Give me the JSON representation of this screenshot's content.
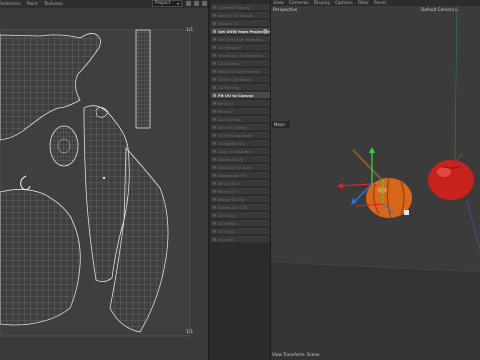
{
  "uv_editor": {
    "menu": [
      "Selection",
      "Paint",
      "Textures"
    ],
    "project_select": "Project",
    "corner_top": "1/1",
    "corner_bottom": "1/1"
  },
  "command_panel": {
    "items": [
      {
        "label": "Optimal Mapping"
      },
      {
        "label": "Realign UV Islands"
      },
      {
        "label": "Terrace UV"
      },
      {
        "label": "Set UVW from Projection",
        "active": true,
        "settings_icon": true
      },
      {
        "label": "Set UVW from Selection"
      },
      {
        "label": "UV Manager"
      },
      {
        "label": "Transform UV Selection"
      },
      {
        "label": "UV Unwrap"
      },
      {
        "label": "Relax UV with Pinning"
      },
      {
        "label": "Stretch UV Islands"
      },
      {
        "label": "UV Packing"
      },
      {
        "label": "Fit UV to Canvas",
        "active": true
      },
      {
        "label": "Mirror U"
      },
      {
        "label": "Mirror V"
      },
      {
        "label": "Lock UV Sel"
      },
      {
        "label": "UV Grid Layout"
      },
      {
        "label": "UV Rectangularize"
      },
      {
        "label": "Straighten UV"
      },
      {
        "label": "Align to Neighbor"
      },
      {
        "label": "Distribute UV"
      },
      {
        "label": "Equalize UV Scale"
      },
      {
        "label": "Randomize UV"
      },
      {
        "label": "Mirror UV X"
      },
      {
        "label": "Mirror UV Y"
      },
      {
        "label": "Rotate UV CW"
      },
      {
        "label": "Rotate UV CCW"
      },
      {
        "label": "UV Tools"
      },
      {
        "label": "UV Peeler"
      },
      {
        "label": "UV Snap"
      },
      {
        "label": "Brushes"
      }
    ]
  },
  "viewport": {
    "menu": [
      "View",
      "Cameras",
      "Display",
      "Options",
      "Filter",
      "Panel"
    ],
    "view_name": "Perspective",
    "camera": "Default Camera",
    "move_label": "Move",
    "status": "View Transform: Scene"
  },
  "colors": {
    "uv_wire": "#d8d8d8",
    "axis_x": "#e02424",
    "axis_y": "#2fd24a",
    "axis_z": "#2f6ff0",
    "pumpkin": "#e0701e",
    "apple": "#c8221c"
  }
}
